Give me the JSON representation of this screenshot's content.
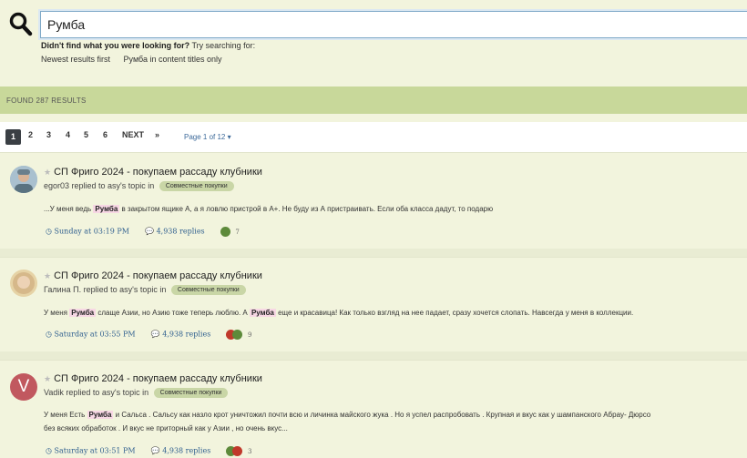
{
  "search": {
    "value": "Румба",
    "hint_bold": "Didn't find what you were looking for?",
    "hint_rest": " Try searching for:",
    "link_newest": "Newest results first",
    "link_titles": "Румба in content titles only"
  },
  "results": {
    "found": "FOUND 287 RESULTS"
  },
  "pager": {
    "pages": [
      "1",
      "2",
      "3",
      "4",
      "5",
      "6"
    ],
    "next": "NEXT",
    "last": "»",
    "page_of": "Page 1 of 12"
  },
  "posts": [
    {
      "title": "СП Фриго 2024 - покупаем рассаду клубники",
      "author": "egor03",
      "replied": " replied to asy's topic in",
      "tag": "Совместные покупки",
      "snip_a": "...У меня ведь ",
      "snip_hl": "Румба",
      "snip_b": " в закрытом ящике А, а я ловлю пристрой в А+. Не буду из А пристраивать. Если оба класса дадут, то подарю",
      "time": "Sunday at 03:19 PM",
      "replies": "4,938 replies",
      "reactions": "7"
    },
    {
      "title": "СП Фриго 2024 - покупаем рассаду клубники",
      "author": "Галина П.",
      "replied": " replied to asy's topic in",
      "tag": "Совместные покупки",
      "snip_a": "У меня ",
      "snip_hl": "Румба",
      "snip_b": " слаще Азии, но Азию тоже теперь люблю. А ",
      "snip_hl2": "Румба",
      "snip_c": " еще и красавица! Как только взгляд на нее падает, сразу хочется слопать. Навсегда у меня в коллекции.",
      "time": "Saturday at 03:55 PM",
      "replies": "4,938 replies",
      "reactions": "9"
    },
    {
      "title": "СП Фриго 2024 - покупаем рассаду клубники",
      "author": "Vadik",
      "avatar_letter": "V",
      "replied": " replied to asy's topic in",
      "tag": "Совместные покупки",
      "snip_a": "У меня Есть ",
      "snip_hl": "Румба",
      "snip_b": " и Сальса . Сальсу как назло крот уничтожил почти всю и личинка майского жука . Но я успел распробовать . Крупная и вкус как у шампанского Абрау- Дюрсо",
      "snip_line2": "без всяких обработок . И вкус не приторный как у Азии , но очень вкус...",
      "time": "Saturday at 03:51 PM",
      "replies": "4,938 replies",
      "reactions": "3"
    }
  ]
}
